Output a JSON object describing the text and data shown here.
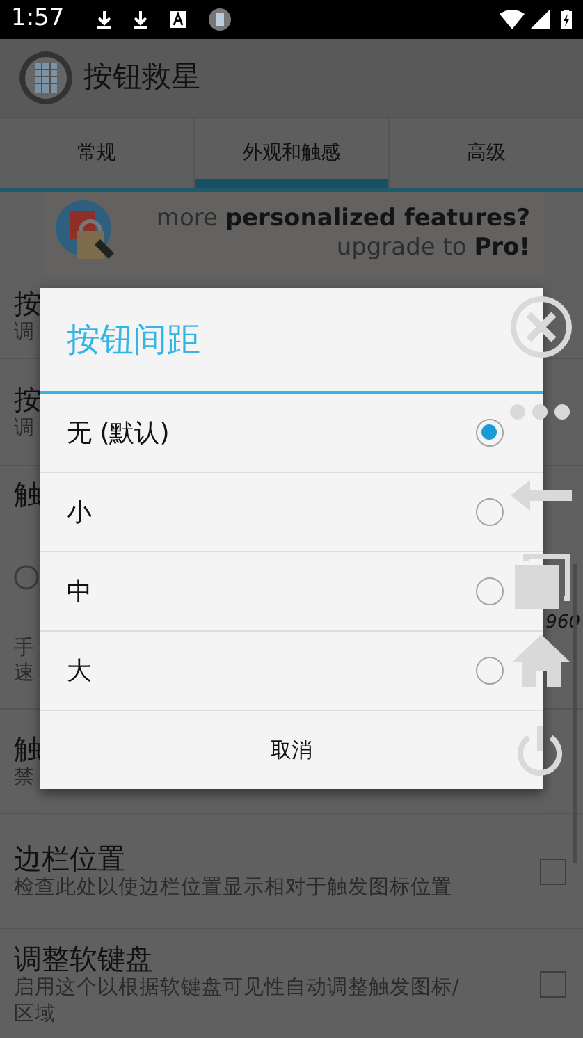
{
  "status_bar": {
    "time": "1:57"
  },
  "app_bar": {
    "title": "按钮救星"
  },
  "tabs": [
    {
      "label": "常规",
      "selected": false
    },
    {
      "label": "外观和触感",
      "selected": true
    },
    {
      "label": "高级",
      "selected": false
    }
  ],
  "banner": {
    "line_1": "more **personalized features?**",
    "line_2": "upgrade to **Pro!**"
  },
  "settings": [
    {
      "kind": "text",
      "title": "按",
      "subtitle": "调"
    },
    {
      "kind": "text",
      "title": "按",
      "subtitle": "调"
    },
    {
      "kind": "slider",
      "title": "触",
      "reading": "960",
      "notes": [
        "手",
        "速"
      ]
    },
    {
      "kind": "text",
      "title": "触",
      "subtitle": "禁"
    },
    {
      "kind": "checkbox",
      "title": "边栏位置",
      "subtitle": "检查此处以使边栏位置显示相对于触发图标位置",
      "checked": false
    },
    {
      "kind": "checkbox",
      "title": "调整软键盘",
      "subtitle": "启用这个以根据软键盘可见性自动调整触发图标/区域",
      "checked": false
    }
  ],
  "dialog": {
    "title": "按钮间距",
    "options": [
      {
        "label": "无 (默认)",
        "selected": true
      },
      {
        "label": "小",
        "selected": false
      },
      {
        "label": "中",
        "selected": false
      },
      {
        "label": "大",
        "selected": false
      }
    ],
    "cancel": "取消"
  }
}
